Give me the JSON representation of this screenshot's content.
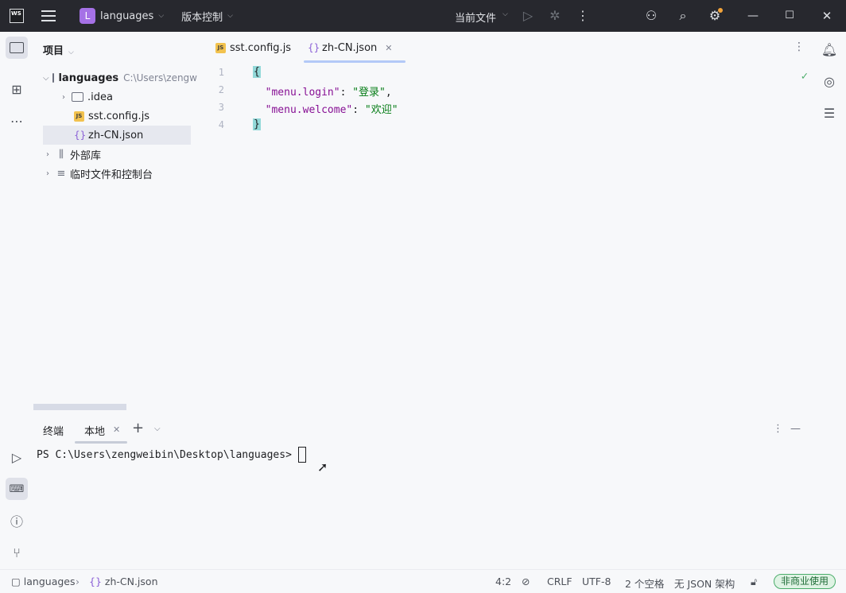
{
  "titlebar": {
    "logo_text": "WS",
    "project_initial": "L",
    "project_name": "languages",
    "vcs_label": "版本控制",
    "run_config": "当前文件"
  },
  "project_panel": {
    "title": "项目",
    "tree": [
      {
        "label": "languages",
        "hint": "C:\\Users\\zengw",
        "type": "folder"
      },
      {
        "label": ".idea",
        "type": "folder"
      },
      {
        "label": "sst.config.js",
        "type": "js"
      },
      {
        "label": "zh-CN.json",
        "type": "json"
      },
      {
        "label": "外部库",
        "type": "lib"
      },
      {
        "label": "临时文件和控制台",
        "type": "scratch"
      }
    ]
  },
  "editor": {
    "tabs": [
      {
        "label": "sst.config.js",
        "active": false
      },
      {
        "label": "zh-CN.json",
        "active": true
      }
    ],
    "lines": [
      {
        "num": "1",
        "text": "{"
      },
      {
        "num": "2",
        "key": "\"menu.login\"",
        "value": "\"登录\"",
        "trail": ","
      },
      {
        "num": "3",
        "key": "\"menu.welcome\"",
        "value": "\"欢迎\"",
        "trail": ""
      },
      {
        "num": "4",
        "text": "}"
      }
    ]
  },
  "terminal": {
    "title": "终端",
    "tab": "本地",
    "prompt": "PS C:\\Users\\zengweibin\\Desktop\\languages>"
  },
  "statusbar": {
    "breadcrumb_project": "languages",
    "breadcrumb_file": "zh-CN.json",
    "position": "4:2",
    "line_ending": "CRLF",
    "encoding": "UTF-8",
    "indent": "2 个空格",
    "schema": "无 JSON 架构",
    "license": "非商业使用"
  }
}
